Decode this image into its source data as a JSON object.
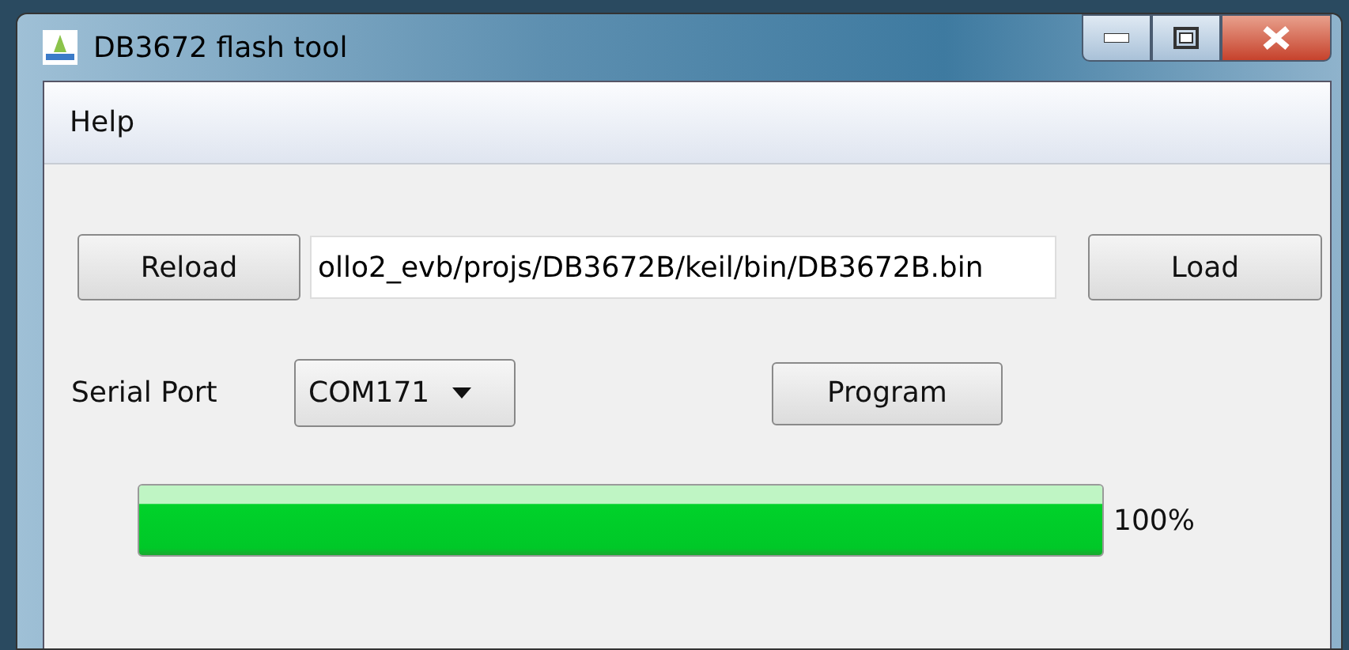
{
  "window": {
    "title": "DB3672 flash tool"
  },
  "menu": [
    {
      "label": "Help"
    }
  ],
  "file_row": {
    "reload_button": "Reload",
    "path": "ollo2_evb/projs/DB3672B/keil/bin/DB3672B.bin",
    "load_button": "Load"
  },
  "port_row": {
    "label": "Serial Port",
    "port": "COM171",
    "program_button": "Program"
  },
  "progress": {
    "level": 1,
    "reading": "100%"
  }
}
